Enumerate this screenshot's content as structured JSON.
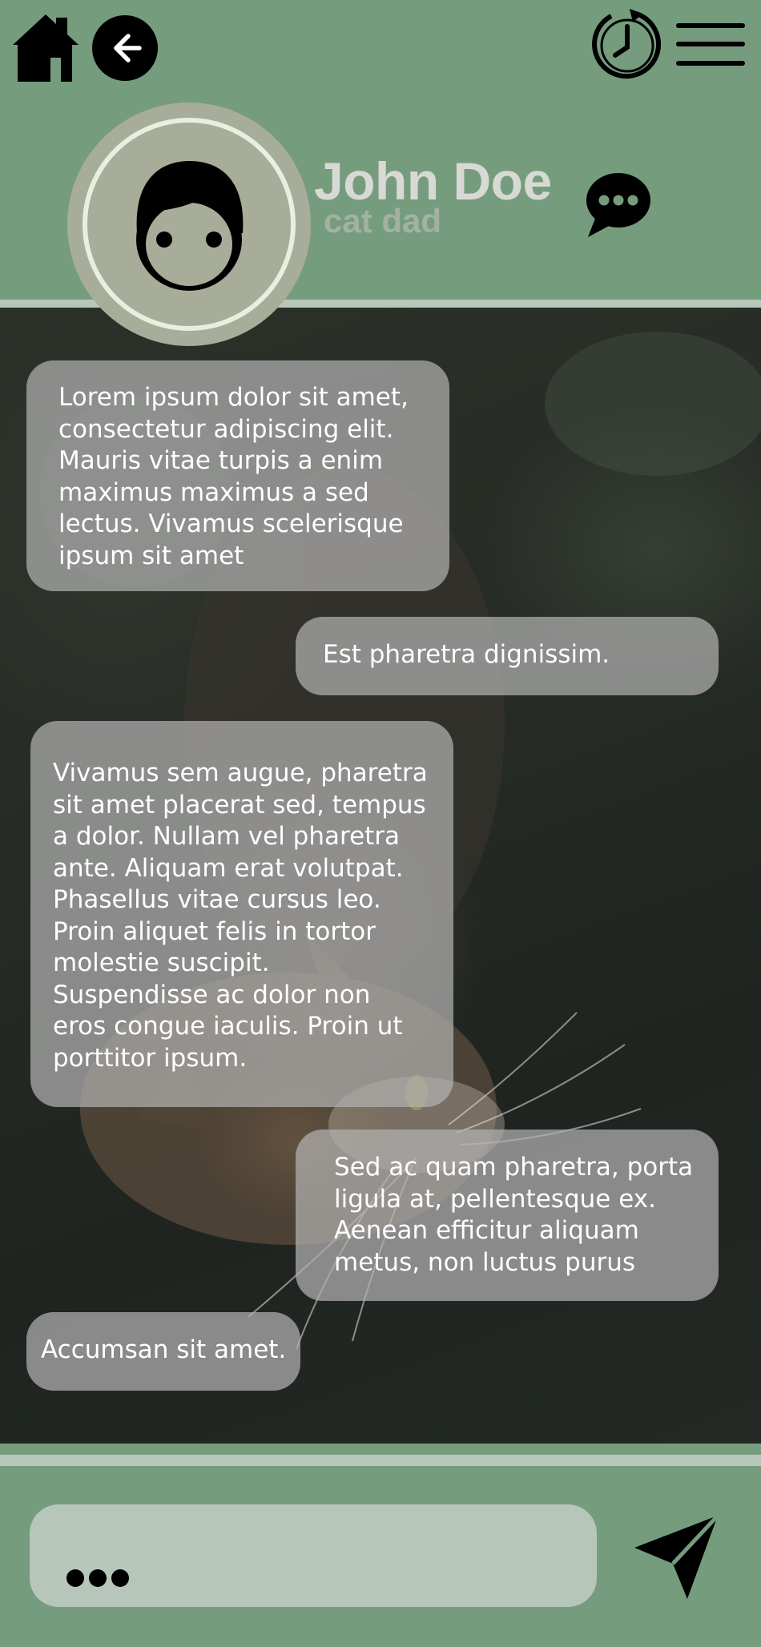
{
  "header": {
    "home_icon": "home-icon",
    "back_icon": "arrow-left-circle-icon",
    "history_icon": "history-clock-icon",
    "menu_icon": "hamburger-menu-icon",
    "chat_icon": "chat-bubble-dots-icon"
  },
  "profile": {
    "name": "John Doe",
    "subtitle": "cat dad",
    "avatar_icon": "user-face-icon"
  },
  "messages": [
    {
      "side": "left",
      "text": "Lorem ipsum dolor sit amet,\nconsectetur adipiscing elit.\nMauris vitae turpis a enim\nmaximus maximus a sed\nlectus. Vivamus scelerisque\nipsum sit amet"
    },
    {
      "side": "right",
      "text": "Est pharetra dignissim."
    },
    {
      "side": "left",
      "text": "Vivamus sem augue, pharetra\nsit amet placerat sed, tempus\na dolor. Nullam vel pharetra\nante. Aliquam erat volutpat.\nPhasellus vitae cursus leo.\nProin aliquet felis in tortor\nmolestie suscipit.\nSuspendisse ac dolor non\neros congue iaculis. Proin ut\nporttitor ipsum."
    },
    {
      "side": "right",
      "text": "Sed ac quam pharetra, porta\nligula at, pellentesque ex.\nAenean efficitur aliquam\nmetus, non luctus purus"
    },
    {
      "side": "left",
      "text": "Accumsan sit amet."
    }
  ],
  "composer": {
    "typing_indicator_icon": "ellipsis-icon",
    "send_icon": "send-paper-plane-icon"
  },
  "colors": {
    "header_green": "#769c7e",
    "divider": "#b7c8bb",
    "bubble": "#b2b2b2",
    "input_bg": "#b6c6ba"
  }
}
